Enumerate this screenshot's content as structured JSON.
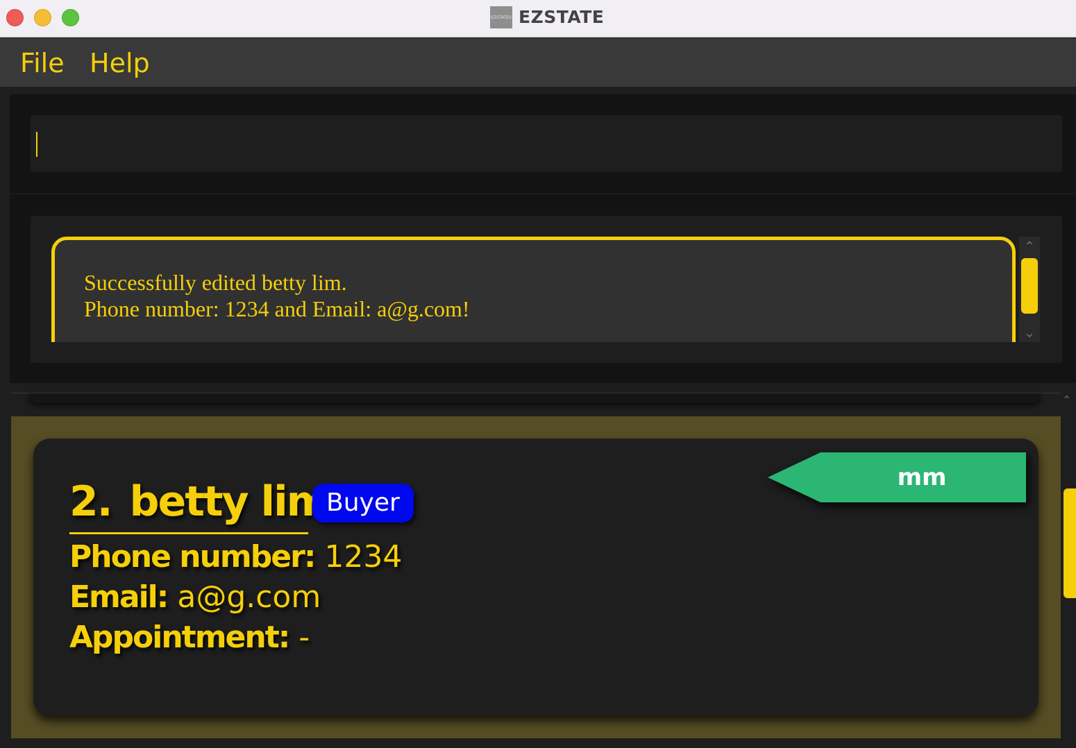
{
  "window": {
    "title": "EZSTATE",
    "icon_text": "EZSTATES"
  },
  "menu": {
    "items": [
      "File",
      "Help"
    ]
  },
  "command": {
    "value": "",
    "placeholder": ""
  },
  "result": {
    "message": "Successfully edited betty lim.\nPhone number: 1234 and Email: a@g.com!"
  },
  "person_card": {
    "index": "2.",
    "name": "betty lim",
    "role": "Buyer",
    "tag": "mm",
    "phone_label": "Phone number:",
    "phone": "1234",
    "email_label": "Email:",
    "email": "a@g.com",
    "appointment_label": "Appointment:",
    "appointment": "-"
  },
  "colors": {
    "accent": "#f5cf0a",
    "role_badge": "#0008ee",
    "tag": "#2bb673",
    "selected_row": "#574d24"
  }
}
